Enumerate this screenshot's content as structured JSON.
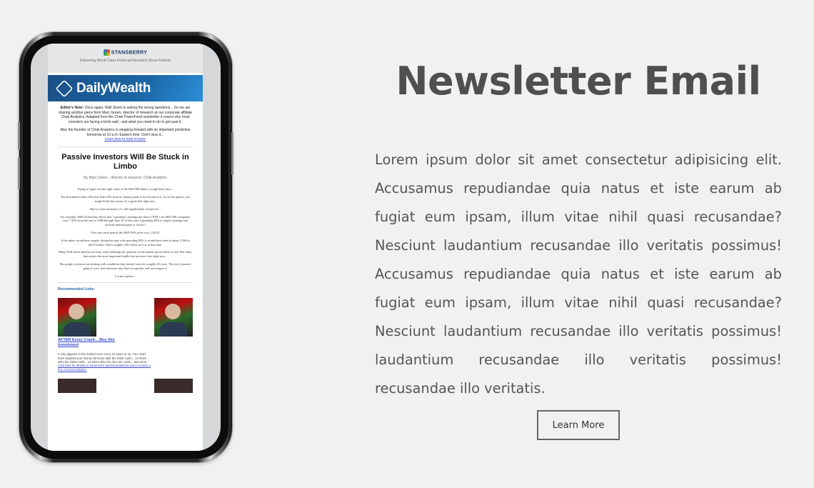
{
  "phone": {
    "email": {
      "logo": "STANSBERRY",
      "logo_sub": "RESEARCH",
      "tagline": "Delivering World Class Financial Research Since Forever",
      "brand": "DailyWealth",
      "editors_note_label": "Editor's Note:",
      "editors_note": "Once again, Wall Street is asking the wrong questions... So we are sharing another piece from Marc Green, director of research at our corporate affiliate Chak Analytics. Adapted from the Chak PowerFeed newsletter it covers why most investors are facing a brick wall - and what you need to do to get past it.",
      "note2": "Also the founder of Chak Analytics is stepping forward with an important prediction tomorrow at 10 a.m. Eastern time. Don't miss it...",
      "note2_link": "Learn how to tune in here.",
      "headline": "Passive Investors Will Be Stuck in Limbo",
      "byline": "By Marc Green , director of research, Chak Analytics",
      "paragraphs": [
        "Trying to figure out the right value of the S&P 500 Index is tough these days...",
        "The benchmark index fell more than 25% from its January peak to its October low. So at first glance, you might think that means it's a good deal right now.",
        "But by some measures, it's still significantly overpriced...",
        "For example, S&P Global data shows that \"operating\" earnings per share (\"EPS\") for S&P 500 companies rose 7.50% from the end of 1988 through June 30 of this year. (Operating EPS is simply earnings that exclude unusual gains or losses.)",
        "Over that same period, the S&P 500's price rose 1,263%.",
        "If the index would have simply climbed in step with operating EPS, it would have been at about 2,360 in mid-October. That's roughly 34% below its low at that time.",
        "Many Wall Street analysts are busy today debating the question, Is the market priced fairly or not? But folks, that misses the most important hurdle that investors face right now...",
        "Put simply, investors are dealing with conditions they haven't seen for roughly 40 years. The era of passive gains is over. And investors who don't accept that will soon regret it.",
        "Let me explain..."
      ],
      "recommended_title": "Recommended Links:",
      "rec_link": "AFTER Every Crash... Buy this Investment",
      "rec_text": "It only appears in the market once every 10 years or so. You could have doubled your money 60 times after the 2000 crash... 12 times after the 2008 crash... 12 times after the dot-com crash... and more.",
      "rec_text_link": "Click here for details on tomorrow's special broadcast and to receive a free recommendation."
    }
  },
  "section": {
    "title": "Newsletter Email",
    "description": "Lorem ipsum dolor sit amet consectetur adipisicing elit. Accusamus repudiandae quia natus et iste earum ab fugiat eum ipsam, illum vitae nihil quasi recusandae? Nesciunt laudantium recusandae illo veritatis possimus! Accusamus repudiandae quia natus et iste earum ab fugiat eum ipsam, illum vitae nihil quasi recusandae? Nesciunt laudantium recusandae illo veritatis possimus! laudantium recusandae illo veritatis possimus! recusandae illo veritatis.",
    "button_label": "Learn More"
  },
  "colors": {
    "background": "#f1f1f1",
    "title": "#4f4f4f",
    "banner": "#1b66a6"
  }
}
